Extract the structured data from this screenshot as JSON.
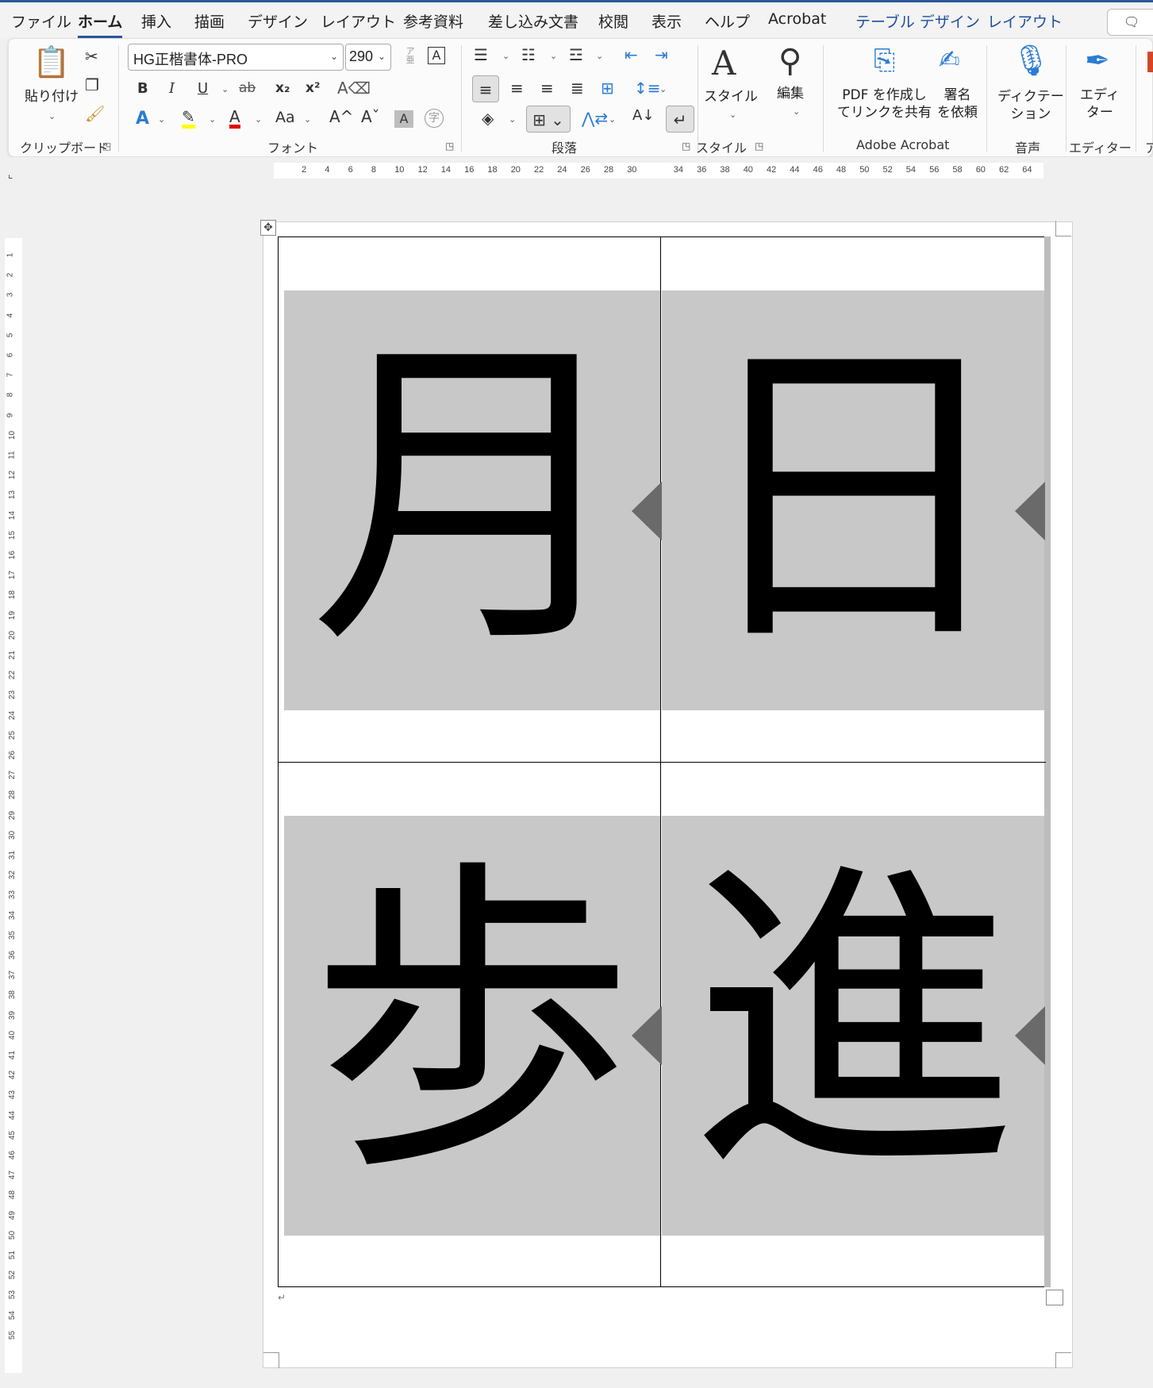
{
  "menu": {
    "tabs": [
      "ファイル",
      "ホーム",
      "挿入",
      "描画",
      "デザイン",
      "レイアウト",
      "参考資料",
      "差し込み文書",
      "校閲",
      "表示",
      "ヘルプ",
      "Acrobat",
      "テーブル デザイン",
      "レイアウト"
    ],
    "active_tab": "ホーム"
  },
  "ribbon": {
    "clipboard": {
      "label": "クリップボード",
      "paste_label": "貼り付け"
    },
    "font": {
      "label": "フォント",
      "font_name": "HG正楷書体-PRO",
      "font_size": "290",
      "bold": "B",
      "italic": "I",
      "underline": "U",
      "strike": "ab",
      "subscript": "x₂",
      "superscript": "x²",
      "change_case": "Aa",
      "grow": "A^",
      "shrink": "Aˇ",
      "shade": "A",
      "enclose": "字",
      "phonetic": "ア亜",
      "border_char": "A"
    },
    "paragraph": {
      "label": "段落"
    },
    "styles": {
      "label": "スタイル",
      "button_label": "スタイル"
    },
    "editing": {
      "button_label": "編集"
    },
    "acrobat": {
      "label": "Adobe Acrobat",
      "pdf_share_line1": "PDF を作成し",
      "pdf_share_line2": "てリンクを共有",
      "sign_line1": "署名",
      "sign_line2": "を依頼"
    },
    "voice": {
      "label": "音声",
      "dictate_line1": "ディクテー",
      "dictate_line2": "ション"
    },
    "editor": {
      "label": "エディター",
      "button_line1": "エディ",
      "button_line2": "ター"
    },
    "partial_group_label": "ア"
  },
  "ruler": {
    "h_numbers": [
      "2",
      "4",
      "6",
      "8",
      "10",
      "12",
      "14",
      "16",
      "18",
      "20",
      "22",
      "24",
      "26",
      "28",
      "30",
      "34",
      "36",
      "38",
      "40",
      "42",
      "44",
      "46",
      "48",
      "50",
      "52",
      "54",
      "56",
      "58",
      "60",
      "62",
      "64"
    ],
    "v_numbers": [
      "1",
      "2",
      "3",
      "4",
      "5",
      "6",
      "7",
      "8",
      "9",
      "10",
      "11",
      "12",
      "13",
      "14",
      "15",
      "16",
      "17",
      "18",
      "19",
      "20",
      "21",
      "22",
      "23",
      "24",
      "25",
      "26",
      "27",
      "28",
      "29",
      "30",
      "31",
      "32",
      "33",
      "34",
      "35",
      "36",
      "37",
      "38",
      "39",
      "40",
      "41",
      "42",
      "43",
      "44",
      "45",
      "46",
      "47",
      "48",
      "49",
      "50",
      "51",
      "52",
      "53",
      "54",
      "55"
    ]
  },
  "document": {
    "cards": [
      "月",
      "日",
      "歩",
      "進"
    ],
    "paragraph_mark": "↵"
  },
  "colors": {
    "accent": "#2b579a",
    "card_bg": "#c8c8c8",
    "marker": "#6a6a6a"
  }
}
